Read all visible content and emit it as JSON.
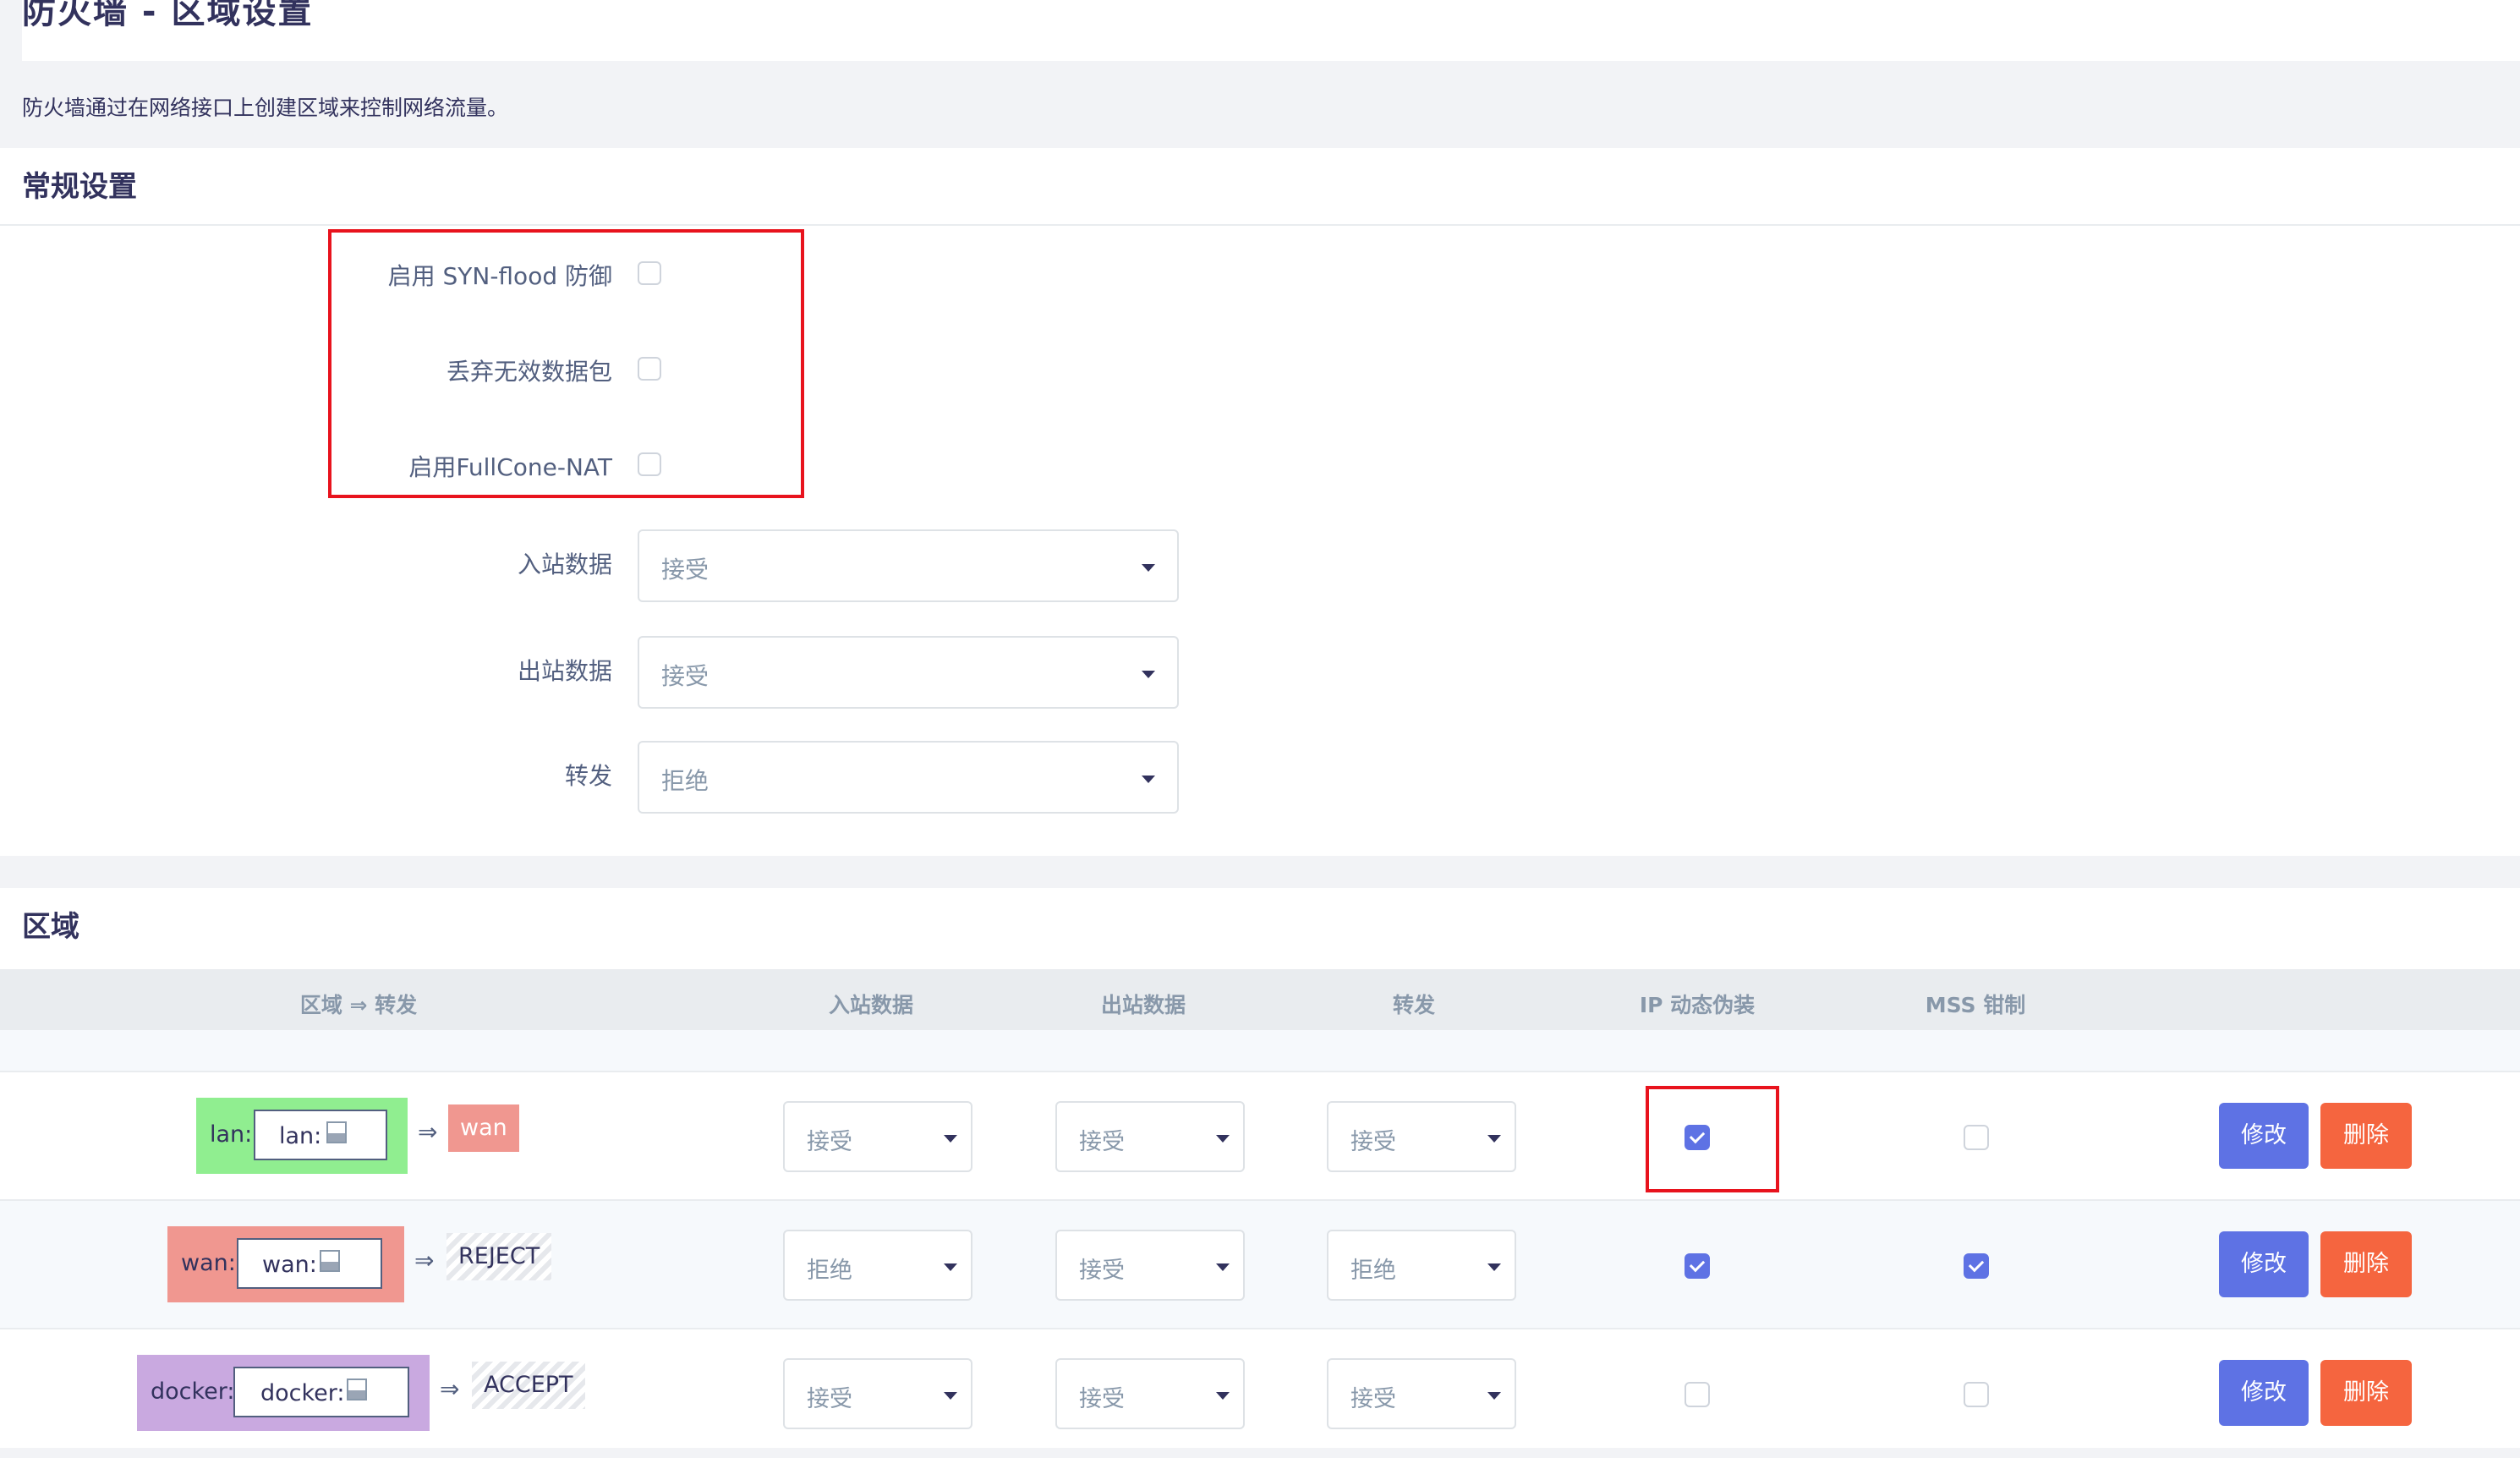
{
  "page": {
    "title": "防火墙 - 区域设置",
    "description": "防火墙通过在网络接口上创建区域来控制网络流量。"
  },
  "general": {
    "header": "常规设置",
    "syn_flood_label": "启用 SYN-flood 防御",
    "drop_invalid_label": "丢弃无效数据包",
    "fullcone_label": "启用FullCone-NAT",
    "input_label": "入站数据",
    "input_value": "接受",
    "output_label": "出站数据",
    "output_value": "接受",
    "forward_label": "转发",
    "forward_value": "拒绝",
    "syn_flood_checked": false,
    "drop_invalid_checked": false,
    "fullcone_checked": false
  },
  "zones": {
    "header": "区域",
    "columns": [
      "区域 ⇒ 转发",
      "入站数据",
      "出站数据",
      "转发",
      "IP 动态伪装",
      "MSS 钳制"
    ],
    "arrow": "⇒",
    "edit_label": "修改",
    "delete_label": "删除",
    "rows": [
      {
        "name": "lan:",
        "inner": "lan:",
        "target": "wan",
        "input": "接受",
        "output": "接受",
        "forward": "接受",
        "masq": true,
        "mss": false,
        "color": "#90ee90"
      },
      {
        "name": "wan:",
        "inner": "wan:",
        "target": "REJECT",
        "input": "拒绝",
        "output": "接受",
        "forward": "拒绝",
        "masq": true,
        "mss": true,
        "color": "#f09790"
      },
      {
        "name": "docker:",
        "inner": "docker:",
        "target": "ACCEPT",
        "input": "接受",
        "output": "接受",
        "forward": "接受",
        "masq": false,
        "mss": false,
        "color": "#c9a9e0"
      }
    ]
  },
  "colors": {
    "accent": "#5e72e4",
    "danger": "#f5653f",
    "highlight": "#e8131d"
  }
}
